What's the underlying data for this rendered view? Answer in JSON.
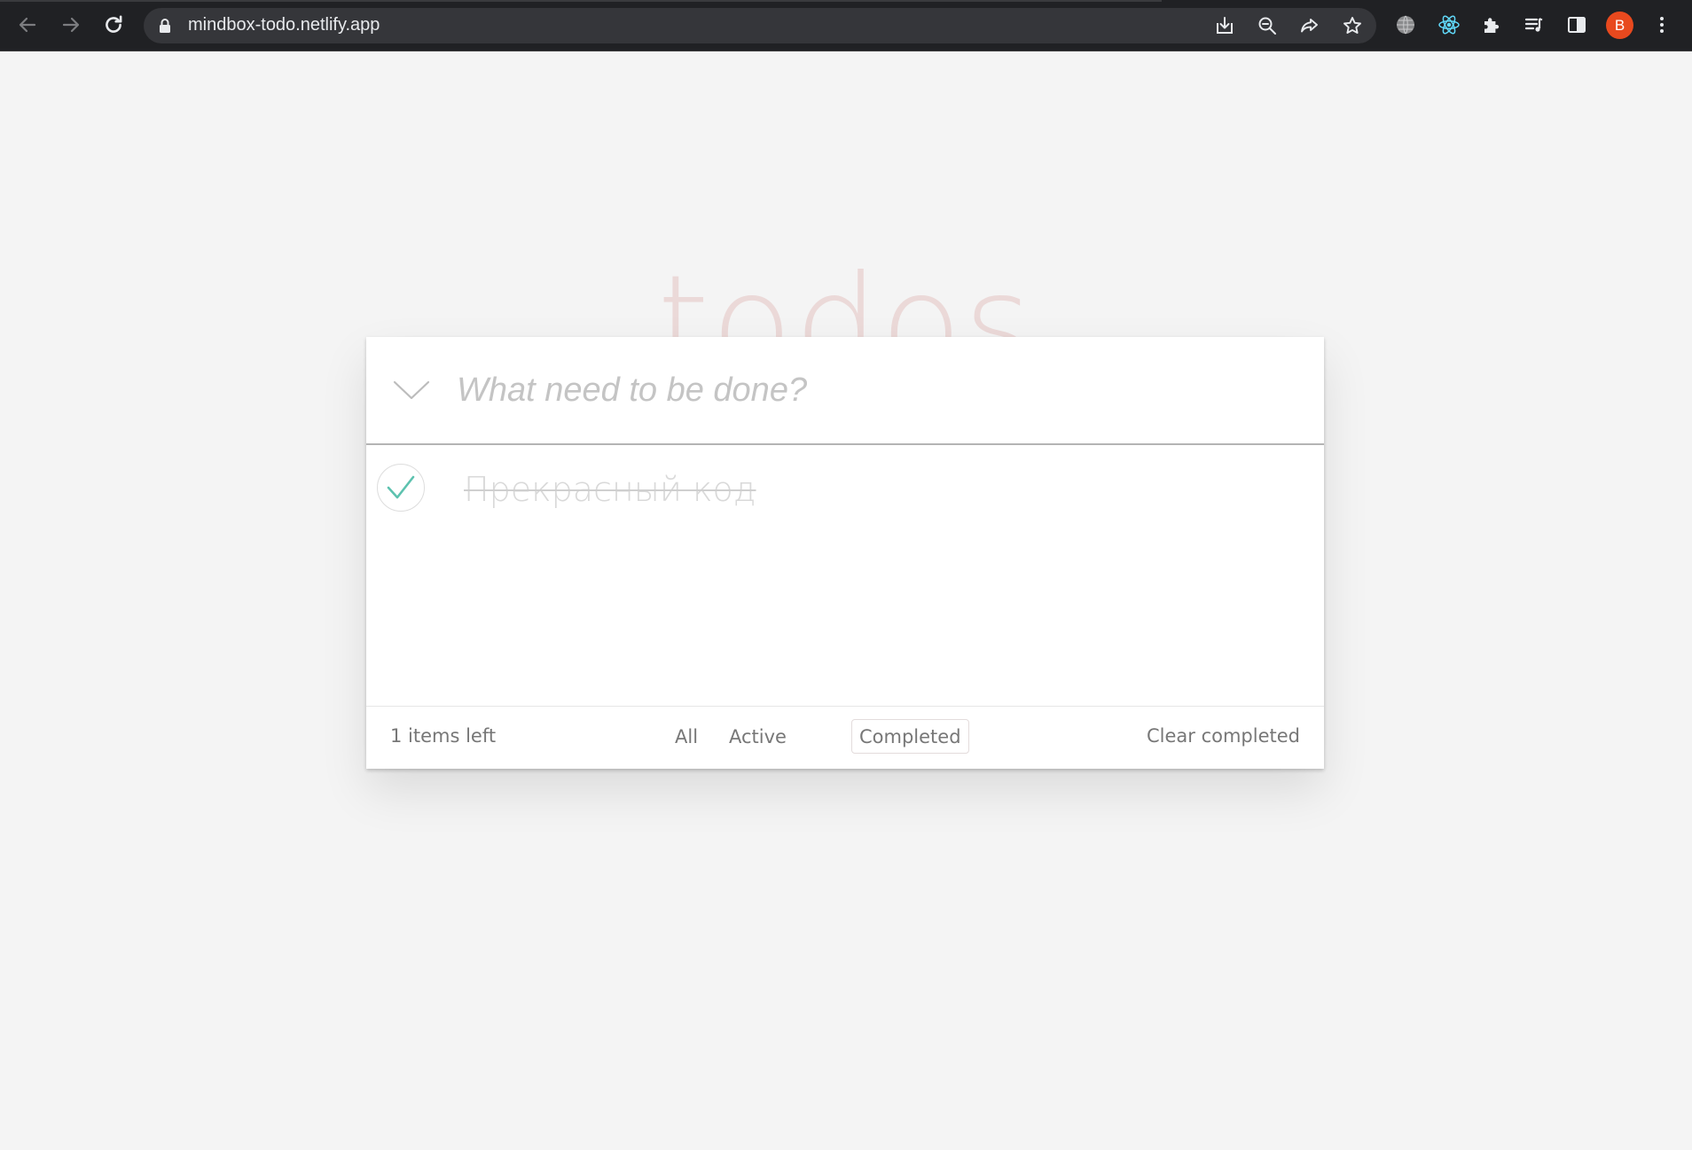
{
  "browser": {
    "url": "mindbox-todo.netlify.app",
    "profile_initial": "B",
    "icons": {
      "back": "arrow-left-icon",
      "forward": "arrow-right-icon",
      "reload": "reload-icon",
      "lock": "lock-icon",
      "install": "install-app-icon",
      "zoom": "zoom-out-icon",
      "share": "share-icon",
      "bookmark": "star-icon",
      "extension_globe": "globe-icon",
      "extension_react": "react-icon",
      "extensions": "puzzle-icon",
      "media": "media-queue-icon",
      "side_panel": "side-panel-icon",
      "menu": "kebab-menu-icon"
    },
    "colors": {
      "toolbar": "#202124",
      "omnibox": "#35363a",
      "avatar": "#e8491e",
      "react": "#61dafb"
    }
  },
  "app": {
    "title": "todos",
    "new_todo_placeholder": "What need to be done?",
    "new_todo_value": "",
    "todos": [
      {
        "text": "Прекрасный код",
        "completed": true
      }
    ],
    "footer": {
      "items_left": "1 items left",
      "filters": [
        {
          "label": "All",
          "selected": false
        },
        {
          "label": "Active",
          "selected": false
        },
        {
          "label": "Completed",
          "selected": true
        }
      ],
      "clear_completed": "Clear completed"
    },
    "colors": {
      "check": "#5dc2af",
      "title": "#ead7d7",
      "background": "#f4f4f4"
    }
  }
}
